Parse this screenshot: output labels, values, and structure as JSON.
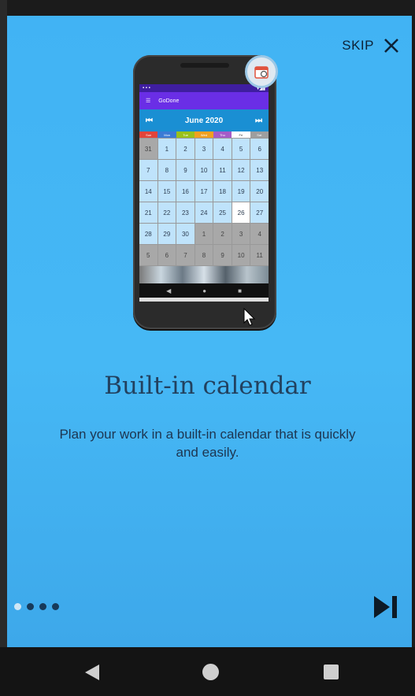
{
  "skip": {
    "label": "SKIP"
  },
  "phone": {
    "app_title": "GoDone",
    "month": "June 2020",
    "weekdays": [
      "Sun",
      "Mon",
      "Tue",
      "Wed",
      "Thu",
      "Fri",
      "Sat"
    ],
    "weekday_colors": [
      "#e2443a",
      "#3a7bd5",
      "#9ac11a",
      "#f0a020",
      "#a55cc8",
      "#ffffff",
      "#9e9e9e"
    ],
    "days": [
      {
        "d": "31",
        "t": "other"
      },
      {
        "d": "1"
      },
      {
        "d": "2"
      },
      {
        "d": "3"
      },
      {
        "d": "4"
      },
      {
        "d": "5"
      },
      {
        "d": "6"
      },
      {
        "d": "7"
      },
      {
        "d": "8"
      },
      {
        "d": "9"
      },
      {
        "d": "10"
      },
      {
        "d": "11"
      },
      {
        "d": "12"
      },
      {
        "d": "13"
      },
      {
        "d": "14"
      },
      {
        "d": "15"
      },
      {
        "d": "16"
      },
      {
        "d": "17"
      },
      {
        "d": "18"
      },
      {
        "d": "19"
      },
      {
        "d": "20"
      },
      {
        "d": "21"
      },
      {
        "d": "22"
      },
      {
        "d": "23"
      },
      {
        "d": "24"
      },
      {
        "d": "25"
      },
      {
        "d": "26",
        "t": "today"
      },
      {
        "d": "27"
      },
      {
        "d": "28"
      },
      {
        "d": "29"
      },
      {
        "d": "30"
      },
      {
        "d": "1",
        "t": "other"
      },
      {
        "d": "2",
        "t": "other"
      },
      {
        "d": "3",
        "t": "other"
      },
      {
        "d": "4",
        "t": "other"
      },
      {
        "d": "5",
        "t": "other"
      },
      {
        "d": "6",
        "t": "other"
      },
      {
        "d": "7",
        "t": "other"
      },
      {
        "d": "8",
        "t": "other"
      },
      {
        "d": "9",
        "t": "other"
      },
      {
        "d": "10",
        "t": "other"
      },
      {
        "d": "11",
        "t": "other"
      }
    ]
  },
  "title": "Built-in calendar",
  "description": "Plan your work in a built-in calendar that is quickly and easily.",
  "pager": {
    "count": 4,
    "active_index": 0
  },
  "colors": {
    "background": "#41b3f4",
    "text_dark": "#22415f",
    "dot": "#173a5a"
  }
}
